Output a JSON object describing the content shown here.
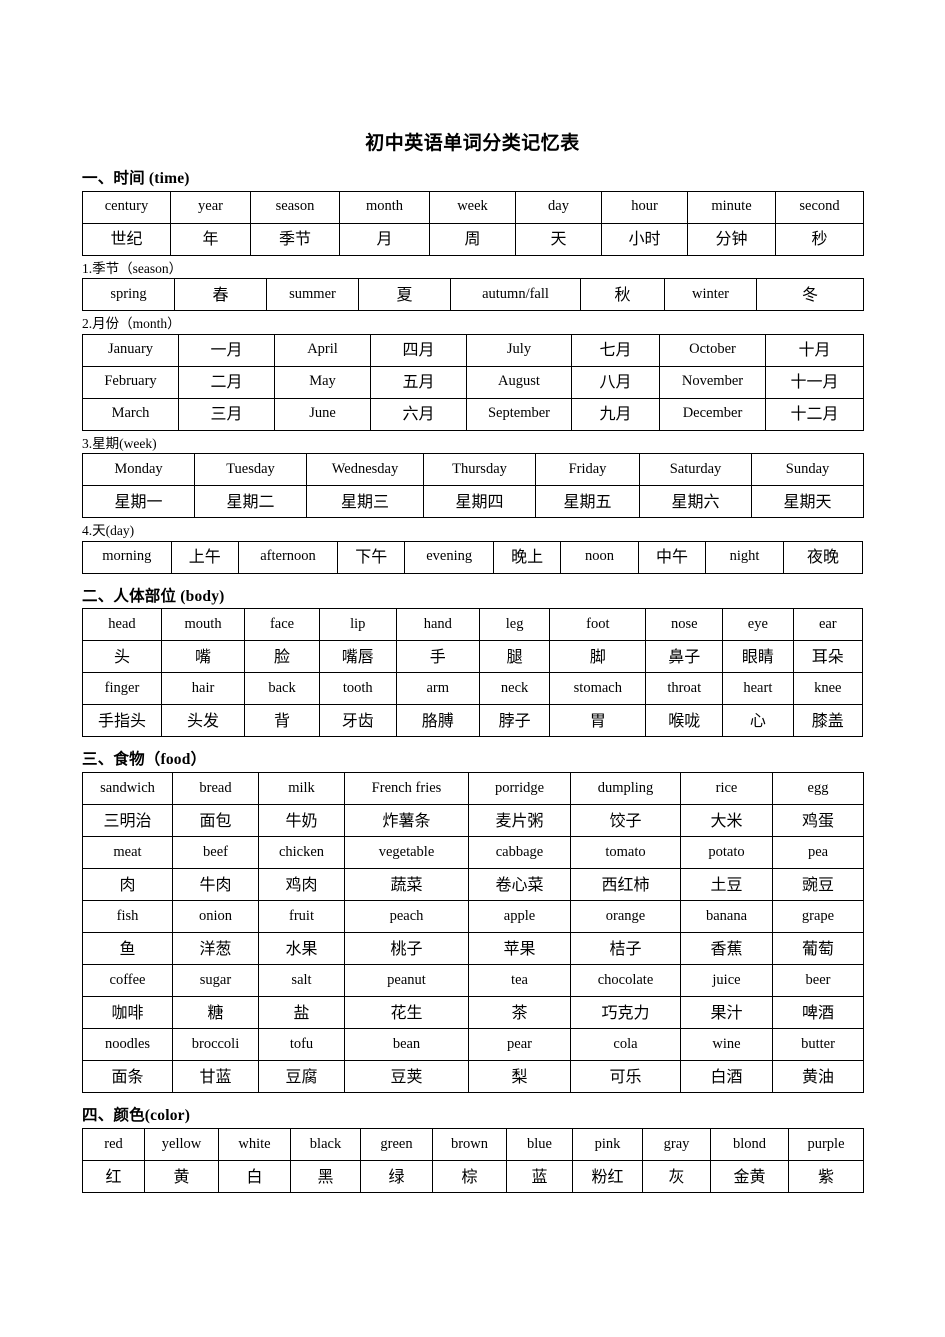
{
  "document": {
    "title": "初中英语单词分类记忆表"
  },
  "sections": [
    {
      "id": "time",
      "heading": "一、时间 (time)",
      "tables": [
        {
          "id": "time-main",
          "cols": 9,
          "widths": [
            88,
            80,
            89,
            90,
            86,
            86,
            86,
            88,
            88
          ],
          "rows": [
            {
              "kind": "en",
              "cells": [
                "century",
                "year",
                "season",
                "month",
                "week",
                "day",
                "hour",
                "minute",
                "second"
              ]
            },
            {
              "kind": "cn",
              "cells": [
                "世纪",
                "年",
                "季节",
                "月",
                "周",
                "天",
                "小时",
                "分钟",
                "秒"
              ]
            }
          ]
        }
      ],
      "subsections": [
        {
          "heading": "1.季节（season）",
          "table": {
            "id": "season",
            "cols": 8,
            "widths": [
              92,
              92,
              92,
              92,
              130,
              84,
              92,
              107
            ],
            "rows": [
              {
                "kind": "mix",
                "cells": [
                  "spring",
                  "春",
                  "summer",
                  "夏",
                  "autumn/fall",
                  "秋",
                  "winter",
                  "冬"
                ],
                "types": [
                  "en",
                  "cn",
                  "en",
                  "cn",
                  "en",
                  "cn",
                  "en",
                  "cn"
                ]
              }
            ]
          }
        },
        {
          "heading": "2.月份（month）",
          "table": {
            "id": "month",
            "cols": 8,
            "widths": [
              96,
              96,
              96,
              96,
              105,
              88,
              106,
              98
            ],
            "rows": [
              {
                "kind": "mix",
                "cells": [
                  "January",
                  "一月",
                  "April",
                  "四月",
                  "July",
                  "七月",
                  "October",
                  "十月"
                ],
                "types": [
                  "en",
                  "cn",
                  "en",
                  "cn",
                  "en",
                  "cn",
                  "en",
                  "cn"
                ]
              },
              {
                "kind": "mix",
                "cells": [
                  "February",
                  "二月",
                  "May",
                  "五月",
                  "August",
                  "八月",
                  "November",
                  "十一月"
                ],
                "types": [
                  "en",
                  "cn",
                  "en",
                  "cn",
                  "en",
                  "cn",
                  "en",
                  "cn"
                ]
              },
              {
                "kind": "mix",
                "cells": [
                  "March",
                  "三月",
                  "June",
                  "六月",
                  "September",
                  "九月",
                  "December",
                  "十二月"
                ],
                "types": [
                  "en",
                  "cn",
                  "en",
                  "cn",
                  "en",
                  "cn",
                  "en",
                  "cn"
                ]
              }
            ]
          }
        },
        {
          "heading": "3.星期(week)",
          "table": {
            "id": "week",
            "cols": 7,
            "widths": [
              112,
              112,
              117,
              112,
              104,
              112,
              112
            ],
            "rows": [
              {
                "kind": "en",
                "cells": [
                  "Monday",
                  "Tuesday",
                  "Wednesday",
                  "Thursday",
                  "Friday",
                  "Saturday",
                  "Sunday"
                ]
              },
              {
                "kind": "cn",
                "cells": [
                  "星期一",
                  "星期二",
                  "星期三",
                  "星期四",
                  "星期五",
                  "星期六",
                  "星期天"
                ]
              }
            ]
          }
        },
        {
          "heading": "4.天(day)",
          "table": {
            "id": "day",
            "cols": 10,
            "widths": [
              82,
              62,
              92,
              62,
              82,
              62,
              72,
              62,
              72,
              73
            ],
            "rows": [
              {
                "kind": "mix",
                "cells": [
                  "morning",
                  "上午",
                  "afternoon",
                  "下午",
                  "evening",
                  "晚上",
                  "noon",
                  "中午",
                  "night",
                  "夜晚"
                ],
                "types": [
                  "en",
                  "cn",
                  "en",
                  "cn",
                  "en",
                  "cn",
                  "en",
                  "cn",
                  "en",
                  "cn"
                ]
              }
            ]
          }
        }
      ]
    },
    {
      "id": "body",
      "heading": "二、人体部位 (body)",
      "tables": [
        {
          "id": "body-main",
          "cols": 10,
          "widths": [
            74,
            78,
            70,
            72,
            78,
            66,
            90,
            72,
            66,
            65
          ],
          "rows": [
            {
              "kind": "en",
              "cells": [
                "head",
                "mouth",
                "face",
                "lip",
                "hand",
                "leg",
                "foot",
                "nose",
                "eye",
                "ear"
              ]
            },
            {
              "kind": "cn",
              "cells": [
                "头",
                "嘴",
                "脸",
                "嘴唇",
                "手",
                "腿",
                "脚",
                "鼻子",
                "眼睛",
                "耳朵"
              ]
            },
            {
              "kind": "en",
              "cells": [
                "finger",
                "hair",
                "back",
                "tooth",
                "arm",
                "neck",
                "stomach",
                "throat",
                "heart",
                "knee"
              ]
            },
            {
              "kind": "cn",
              "cells": [
                "手指头",
                "头发",
                "背",
                "牙齿",
                "胳膊",
                "脖子",
                "胃",
                "喉咙",
                "心",
                "膝盖"
              ]
            }
          ]
        }
      ],
      "subsections": []
    },
    {
      "id": "food",
      "heading": "三、食物（food）",
      "tables": [
        {
          "id": "food-main",
          "cols": 8,
          "widths": [
            90,
            86,
            86,
            124,
            102,
            110,
            92,
            91
          ],
          "rows": [
            {
              "kind": "en",
              "cells": [
                "sandwich",
                "bread",
                "milk",
                "French fries",
                "porridge",
                "dumpling",
                "rice",
                "egg"
              ]
            },
            {
              "kind": "cn",
              "cells": [
                "三明治",
                "面包",
                "牛奶",
                "炸薯条",
                "麦片粥",
                "饺子",
                "大米",
                "鸡蛋"
              ]
            },
            {
              "kind": "en",
              "cells": [
                "meat",
                "beef",
                "chicken",
                "vegetable",
                "cabbage",
                "tomato",
                "potato",
                "pea"
              ]
            },
            {
              "kind": "cn",
              "cells": [
                "肉",
                "牛肉",
                "鸡肉",
                "蔬菜",
                "卷心菜",
                "西红柿",
                "土豆",
                "豌豆"
              ]
            },
            {
              "kind": "en",
              "cells": [
                "fish",
                "onion",
                "fruit",
                "peach",
                "apple",
                "orange",
                "banana",
                "grape"
              ]
            },
            {
              "kind": "cn",
              "cells": [
                "鱼",
                "洋葱",
                "水果",
                "桃子",
                "苹果",
                "桔子",
                "香蕉",
                "葡萄"
              ]
            },
            {
              "kind": "en",
              "cells": [
                "coffee",
                "sugar",
                "salt",
                "peanut",
                "tea",
                "chocolate",
                "juice",
                "beer"
              ]
            },
            {
              "kind": "cn",
              "cells": [
                "咖啡",
                "糖",
                "盐",
                "花生",
                "茶",
                "巧克力",
                "果汁",
                "啤酒"
              ]
            },
            {
              "kind": "en",
              "cells": [
                "noodles",
                "broccoli",
                "tofu",
                "bean",
                "pear",
                "cola",
                "wine",
                "butter"
              ]
            },
            {
              "kind": "cn",
              "cells": [
                "面条",
                "甘蓝",
                "豆腐",
                "豆荚",
                "梨",
                "可乐",
                "白酒",
                "黄油"
              ]
            }
          ]
        }
      ],
      "subsections": []
    },
    {
      "id": "color",
      "heading": "四、颜色(color)",
      "tables": [
        {
          "id": "color-main",
          "cols": 11,
          "widths": [
            62,
            74,
            72,
            70,
            72,
            74,
            66,
            70,
            68,
            78,
            75
          ],
          "rows": [
            {
              "kind": "en",
              "cells": [
                "red",
                "yellow",
                "white",
                "black",
                "green",
                "brown",
                "blue",
                "pink",
                "gray",
                "blond",
                "purple"
              ]
            },
            {
              "kind": "cn",
              "cells": [
                "红",
                "黄",
                "白",
                "黑",
                "绿",
                "棕",
                "蓝",
                "粉红",
                "灰",
                "金黄",
                "紫"
              ]
            }
          ]
        }
      ],
      "subsections": []
    }
  ]
}
